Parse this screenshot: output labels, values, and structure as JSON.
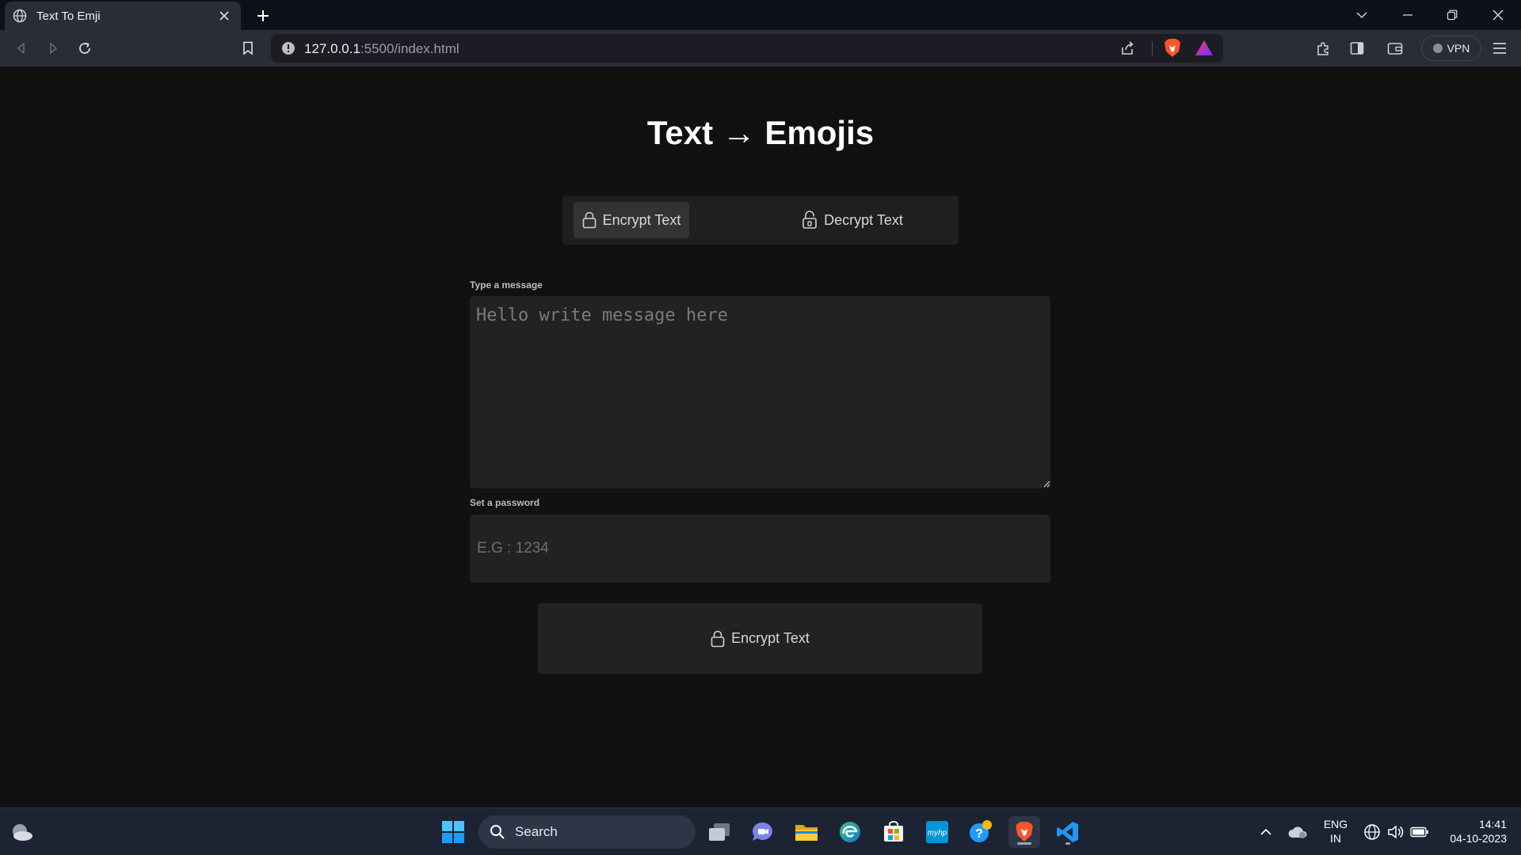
{
  "browser": {
    "tab_title": "Text To Emji",
    "url_host": "127.0.0.1",
    "url_rest": ":5500/index.html",
    "vpn_label": "VPN"
  },
  "page": {
    "title": "Text → Emojis",
    "modes": [
      {
        "label": "Encrypt Text",
        "icon": "lock-icon",
        "active": true
      },
      {
        "label": "Decrypt Text",
        "icon": "unlock-icon",
        "active": false
      }
    ],
    "message_label": "Type a message",
    "message_placeholder": "Hello write message here",
    "message_value": "",
    "password_label": "Set a password",
    "password_placeholder": "E.G : 1234",
    "password_value": "",
    "submit_label": "Encrypt Text"
  },
  "taskbar": {
    "search_label": "Search",
    "language": "ENG",
    "region": "IN",
    "time": "14:41",
    "date": "04-10-2023"
  },
  "colors": {
    "background": "#111111",
    "surface": "#222222",
    "active_tab": "#333333",
    "text": "#ffffff"
  }
}
